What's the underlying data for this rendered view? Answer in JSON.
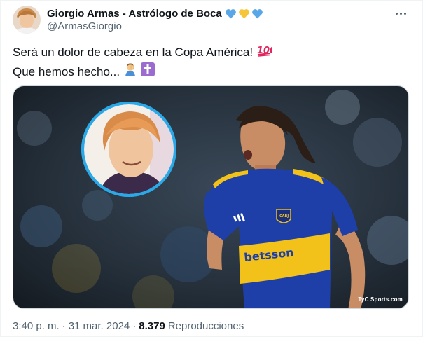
{
  "author": {
    "display_name": "Giorgio Armas - Astrólogo de Boca",
    "handle": "@ArmasGiorgio",
    "name_emojis": [
      "blue-heart-icon",
      "yellow-heart-icon",
      "blue-heart-icon"
    ]
  },
  "tweet": {
    "line1": "Será un dolor de cabeza en la Copa América!",
    "line1_emoji": "hundred-points-icon",
    "line2": "Que hemos hecho...",
    "line2_emojis": [
      "facepalm-icon",
      "latin-cross-icon"
    ]
  },
  "media": {
    "watermark": "TyC Sports.com",
    "jersey_sponsor": "betsson",
    "alt": "Player in blue and yellow jersey with inset photo of the author"
  },
  "meta": {
    "time": "3:40 p. m.",
    "separator": "·",
    "date": "31 mar. 2024",
    "views_count": "8.379",
    "views_label": "Reproducciones"
  },
  "colors": {
    "blue_heart": "#5aa7e8",
    "yellow_heart": "#f5c63a",
    "boca_blue": "#1e3fa8",
    "boca_yellow": "#f2c21a",
    "secondary_text": "#536471"
  }
}
